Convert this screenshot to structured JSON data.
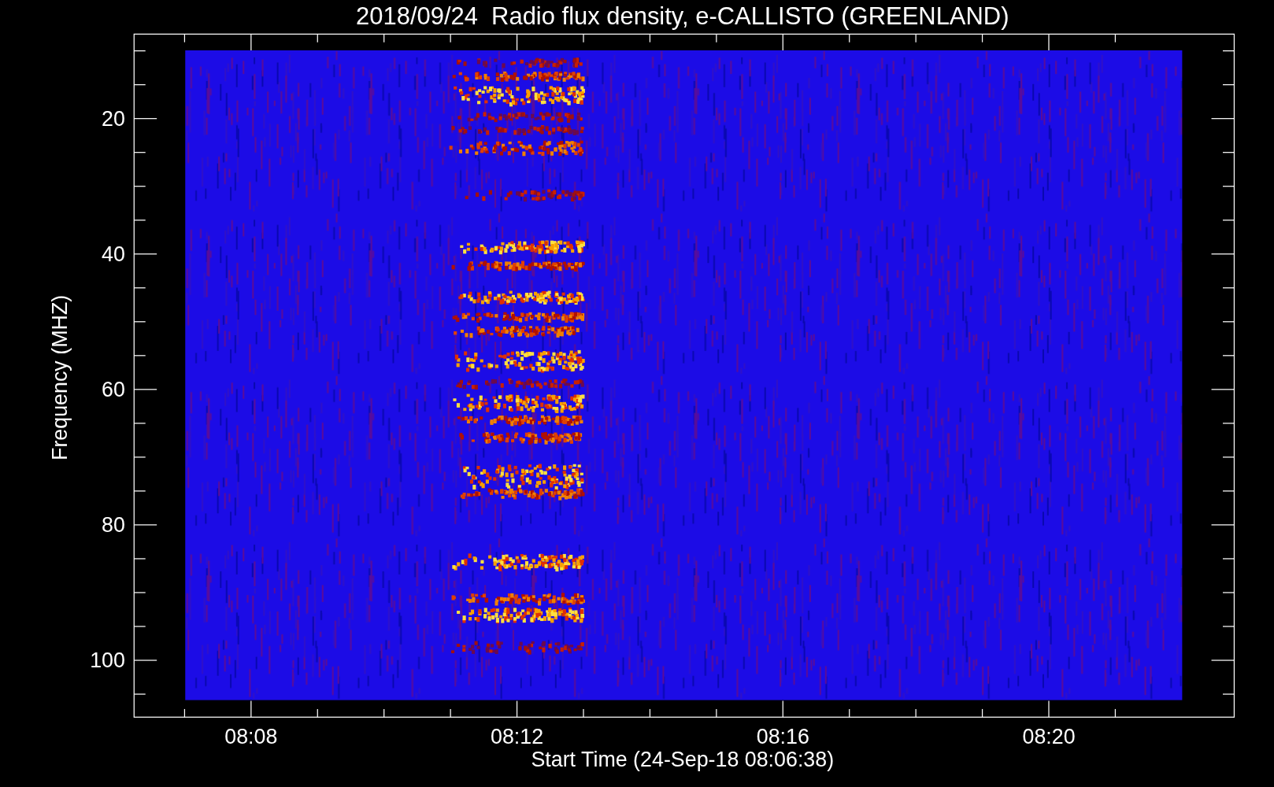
{
  "title": "2018/09/24  Radio flux density, e-CALLISTO (GREENLAND)",
  "y_axis": {
    "label": "Frequency (MHZ)",
    "ticks": [
      "20",
      "40",
      "60",
      "80",
      "100"
    ]
  },
  "x_axis": {
    "label": "Start Time (24-Sep-18 08:06:38)",
    "ticks": [
      "08:08",
      "08:12",
      "08:16",
      "08:20"
    ]
  }
}
